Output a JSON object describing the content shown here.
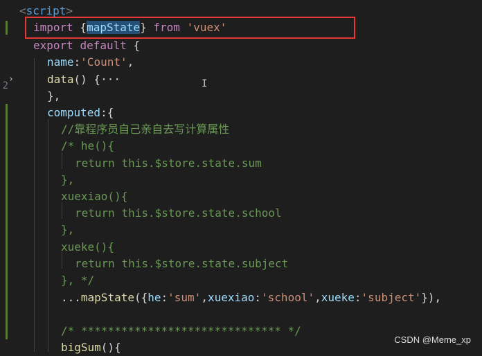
{
  "gutter": {
    "line_numbers": [
      "",
      "",
      "",
      "",
      "",
      "2",
      "",
      "",
      "",
      "",
      "",
      "",
      "",
      "",
      "",
      "",
      "",
      "",
      "",
      "",
      "",
      ""
    ],
    "fold_icon": "chevron-right-icon"
  },
  "code": {
    "l0": {
      "open": "<",
      "tag": "script",
      "close": ">"
    },
    "l1": {
      "kw": "import",
      "p1": " {",
      "name": "mapState",
      "p2": "} ",
      "from": "from",
      "sp": " ",
      "str": "'vuex'"
    },
    "l2": {
      "kw": "export",
      "sp": " ",
      "kw2": "default",
      "p": " {"
    },
    "l3": {
      "key": "name",
      "p": ":",
      "str": "'Count'",
      "p2": ","
    },
    "l4": {
      "fn": "data",
      "p": "() {",
      "ell": "···"
    },
    "l5": {
      "p": "},"
    },
    "l6": {
      "key": "computed",
      "p": ":{"
    },
    "l7": {
      "cm": "//靠程序员自己亲自去写计算属性"
    },
    "l8": {
      "cm": "/* he(){"
    },
    "l9": {
      "cm": "return this.$store.state.sum"
    },
    "l10": {
      "cm": "},"
    },
    "l11": {
      "cm": "xuexiao(){"
    },
    "l12": {
      "cm": "return this.$store.state.school"
    },
    "l13": {
      "cm": "},"
    },
    "l14": {
      "cm": "xueke(){"
    },
    "l15": {
      "cm": "return this.$store.state.subject"
    },
    "l16": {
      "cm": "}, */"
    },
    "l17": {
      "spread": "...",
      "fn": "mapState",
      "p1": "({",
      "k1": "he",
      "c1": ":",
      "s1": "'sum'",
      "cm1": ",",
      "k2": "xuexiao",
      "c2": ":",
      "s2": "'school'",
      "cm2": ",",
      "k3": "xueke",
      "c3": ":",
      "s3": "'subject'",
      "p2": "}),"
    },
    "l19": {
      "cm": "/* ****************************** */"
    },
    "l20": {
      "fn": "bigSum",
      "p": "(){"
    }
  },
  "watermark": "CSDN @Meme_xp",
  "colors": {
    "highlight_box": "#e53935",
    "keyword": "#c586c0",
    "function": "#dcdcaa",
    "string": "#ce9178",
    "comment": "#6a9955"
  }
}
